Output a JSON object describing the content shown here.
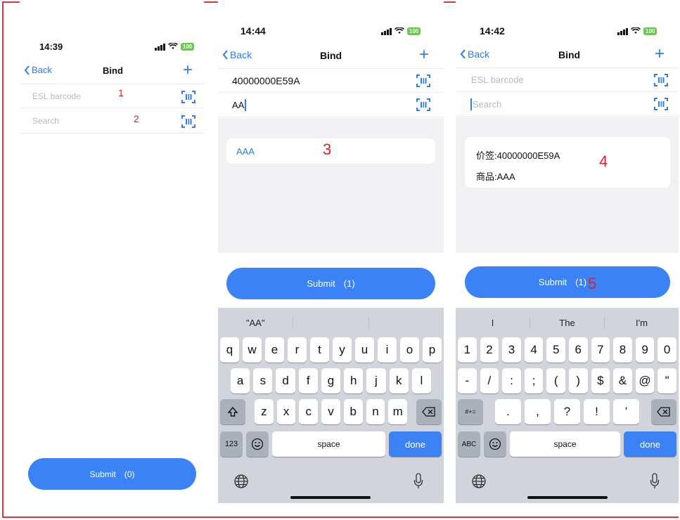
{
  "p1": {
    "time": "14:39",
    "battery": "100",
    "back": "Back",
    "title": "Bind",
    "plus": "+",
    "barcode_placeholder": "ESL barcode",
    "search_placeholder": "Search",
    "ann1": "1",
    "ann2": "2",
    "submit": "Submit",
    "count": "(0)"
  },
  "p2": {
    "time": "14:44",
    "battery": "100",
    "back": "Back",
    "title": "Bind",
    "plus": "+",
    "barcode_value": "40000000E59A",
    "search_value": "AA",
    "result": "AAA",
    "ann3": "3",
    "submit": "Submit",
    "count": "(1)",
    "suggestions": [
      "\"AA\"",
      "",
      ""
    ],
    "row1": [
      "q",
      "w",
      "e",
      "r",
      "t",
      "y",
      "u",
      "i",
      "o",
      "p"
    ],
    "row2": [
      "a",
      "s",
      "d",
      "f",
      "g",
      "h",
      "j",
      "k",
      "l"
    ],
    "row3": [
      "z",
      "x",
      "c",
      "v",
      "b",
      "n",
      "m"
    ],
    "k123": "123",
    "space": "space",
    "done": "done"
  },
  "p3": {
    "time": "14:42",
    "battery": "100",
    "back": "Back",
    "title": "Bind",
    "plus": "+",
    "barcode_placeholder": "ESL barcode",
    "search_placeholder": "Search",
    "line1": "价签:40000000E59A",
    "line2": "商品:AAA",
    "ann4": "4",
    "submit": "Submit",
    "count": "(1)",
    "ann5": "5",
    "suggestions": [
      "I",
      "The",
      "I'm"
    ],
    "row1": [
      "1",
      "2",
      "3",
      "4",
      "5",
      "6",
      "7",
      "8",
      "9",
      "0"
    ],
    "row2": [
      "-",
      "/",
      ":",
      ";",
      "(",
      ")",
      "$",
      "&",
      "@",
      "\""
    ],
    "row3": [
      ".",
      ",",
      "?",
      "!",
      "'"
    ],
    "kabc": "ABC",
    "ksym": "#+=",
    "space": "space",
    "done": "done"
  },
  "corner": "ˀ"
}
